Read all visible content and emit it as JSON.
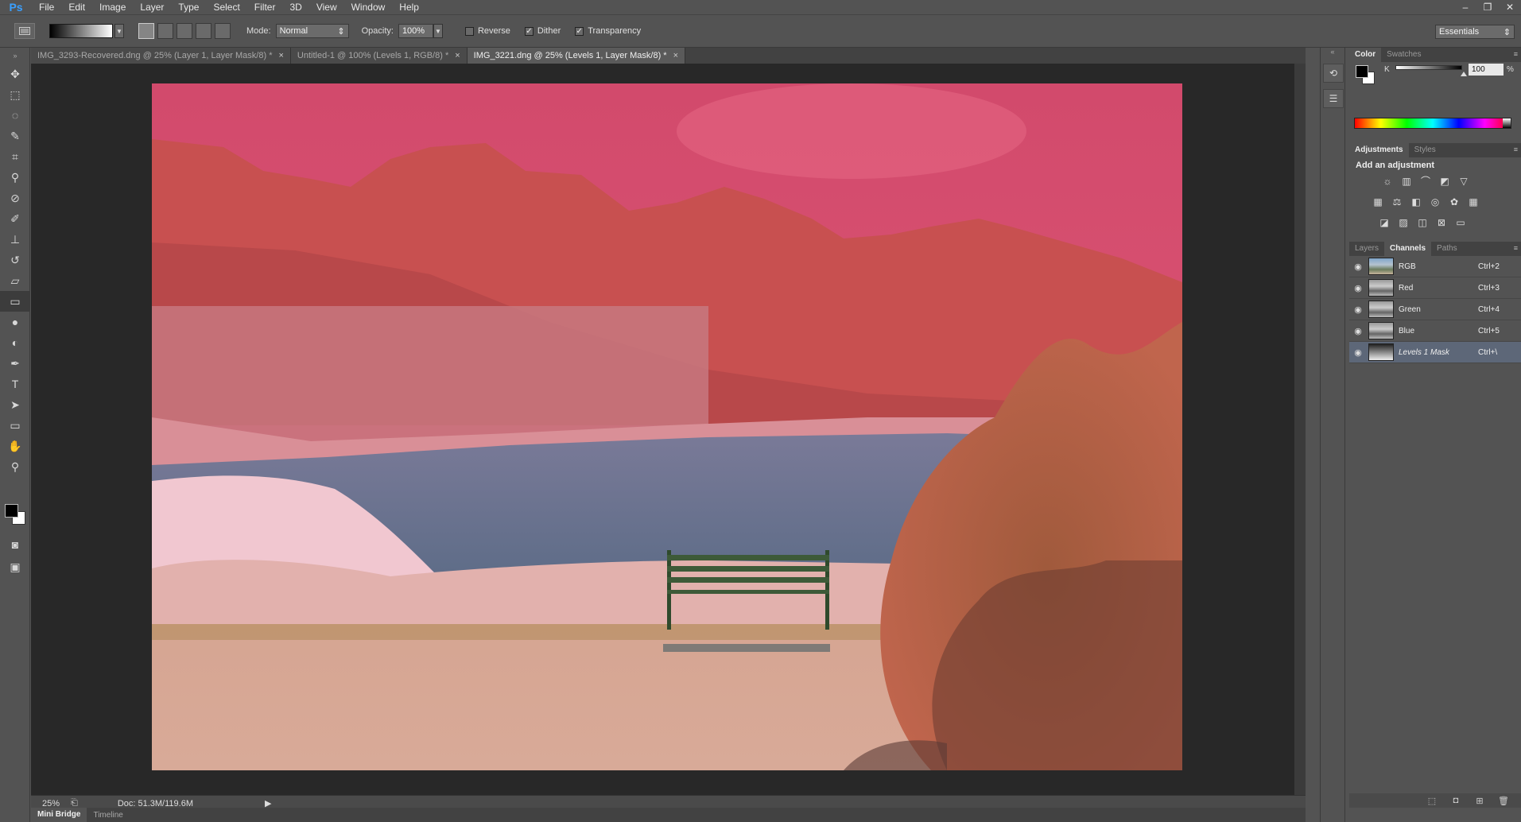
{
  "app": {
    "logo": "Ps"
  },
  "menu": [
    "File",
    "Edit",
    "Image",
    "Layer",
    "Type",
    "Select",
    "Filter",
    "3D",
    "View",
    "Window",
    "Help"
  ],
  "window_controls": [
    "–",
    "❐",
    "✕"
  ],
  "options": {
    "mode_label": "Mode:",
    "mode_value": "Normal",
    "opacity_label": "Opacity:",
    "opacity_value": "100%",
    "reverse_label": "Reverse",
    "dither_label": "Dither",
    "transparency_label": "Transparency",
    "reverse_checked": false,
    "dither_checked": true,
    "transparency_checked": true,
    "workspace": "Essentials"
  },
  "tabs": [
    {
      "label": "IMG_3293-Recovered.dng @ 25% (Layer 1, Layer Mask/8) *",
      "active": false
    },
    {
      "label": "Untitled-1 @ 100% (Levels 1, RGB/8) *",
      "active": false
    },
    {
      "label": "IMG_3221.dng @ 25% (Levels 1, Layer Mask/8) *",
      "active": true
    }
  ],
  "status": {
    "zoom": "25%",
    "doc_info": "Doc: 51.3M/119.6M"
  },
  "bottom_tabs": [
    "Mini Bridge",
    "Timeline"
  ],
  "color_panel": {
    "tabs": [
      "Color",
      "Swatches"
    ],
    "channel_label": "K",
    "value": "100",
    "unit": "%"
  },
  "adjustments_panel": {
    "tabs": [
      "Adjustments",
      "Styles"
    ],
    "title": "Add an adjustment"
  },
  "channels_panel": {
    "tabs": [
      "Layers",
      "Channels",
      "Paths"
    ],
    "rows": [
      {
        "name": "RGB",
        "shortcut": "Ctrl+2",
        "selected": false
      },
      {
        "name": "Red",
        "shortcut": "Ctrl+3",
        "selected": false
      },
      {
        "name": "Green",
        "shortcut": "Ctrl+4",
        "selected": false
      },
      {
        "name": "Blue",
        "shortcut": "Ctrl+5",
        "selected": false
      },
      {
        "name": "Levels 1 Mask",
        "shortcut": "Ctrl+\\",
        "selected": true
      }
    ]
  }
}
